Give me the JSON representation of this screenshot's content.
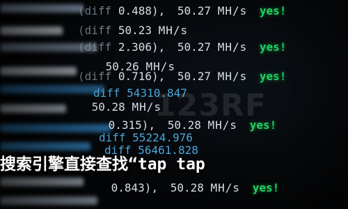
{
  "terminal": {
    "lines": [
      {
        "prefix": "(diff",
        "value": "0.488),",
        "rate": "50.27",
        "unit": "MH/s",
        "status": "yes!"
      },
      {
        "prefix": "(diff",
        "value": "50.23",
        "unit": "MH/s"
      },
      {
        "prefix": "(diff",
        "value": "2.306),",
        "rate": "50.27",
        "unit": "MH/s",
        "status": "yes!"
      },
      {
        "prefix": "",
        "value": "50.26",
        "unit": "MH/s"
      },
      {
        "prefix": "(diff",
        "value": "0.716),",
        "rate": "50.27",
        "unit": "MH/s",
        "status": "yes!"
      },
      {
        "prefix": "diff",
        "value": "54310.847"
      },
      {
        "prefix": "",
        "value": "50.28",
        "unit": "MH/s"
      },
      {
        "prefix": "",
        "value": "0.315),",
        "rate": "50.28",
        "unit": "MH/s",
        "status": "yes!"
      },
      {
        "prefix": "diff",
        "value": "55224.976"
      },
      {
        "prefix": "diff",
        "value": "56461.828"
      },
      {
        "prefix": "",
        "value": "0.843),",
        "rate": "50.28",
        "unit": "MH/s",
        "status": "yes!"
      }
    ]
  },
  "overlay": {
    "text": "搜索引擎直接查找“tap tap"
  },
  "watermark": {
    "text": "123RF"
  },
  "colors": {
    "green": "#1fd162",
    "blue": "#4aa7d8",
    "white": "#d9dee6"
  }
}
